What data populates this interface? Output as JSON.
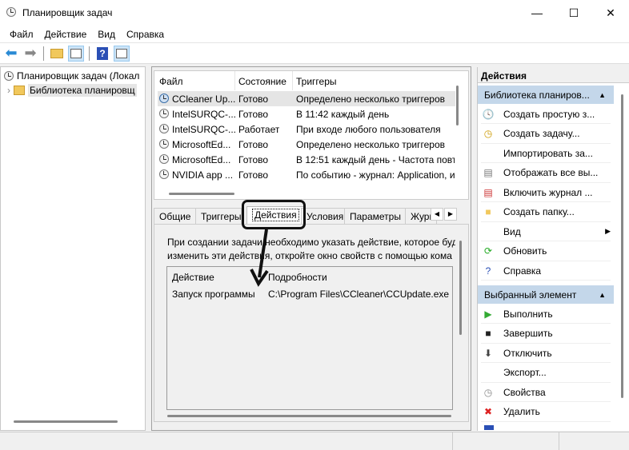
{
  "window": {
    "title": "Планировщик задач"
  },
  "menu": [
    "Файл",
    "Действие",
    "Вид",
    "Справка"
  ],
  "tree": {
    "root": "Планировщик задач (Локал",
    "library": "Библиотека планировщ"
  },
  "tasks": {
    "headers": [
      "Файл",
      "Состояние",
      "Триггеры"
    ],
    "rows": [
      {
        "name": "CCleaner Up...",
        "status": "Готово",
        "trigger": "Определено несколько триггеров"
      },
      {
        "name": "IntelSURQC-...",
        "status": "Готово",
        "trigger": "В 11:42 каждый день"
      },
      {
        "name": "IntelSURQC-...",
        "status": "Работает",
        "trigger": "При входе любого пользователя"
      },
      {
        "name": "MicrosoftEd...",
        "status": "Готово",
        "trigger": "Определено несколько триггеров"
      },
      {
        "name": "MicrosoftEd...",
        "status": "Готово",
        "trigger": "В 12:51 каждый день - Частота повто"
      },
      {
        "name": "NVIDIA app ...",
        "status": "Готово",
        "trigger": "По событию - журнал: Application, и"
      }
    ]
  },
  "tabs": [
    "Общие",
    "Триггеры",
    "Действия",
    "Условия",
    "Параметры",
    "Журнал"
  ],
  "details": {
    "description_line1": "При создании задачи необходимо указать действие, которое буд",
    "description_line2": "изменить эти действия, откройте окно свойств с помощью кома",
    "headers": [
      "Действие",
      "Подробности"
    ],
    "rows": [
      {
        "action": "Запуск программы",
        "details": "C:\\Program Files\\CCleaner\\CCUpdate.exe"
      }
    ]
  },
  "actions_pane": {
    "title": "Действия",
    "section1": "Библиотека планиров...",
    "items1": [
      "Создать простую з...",
      "Создать задачу...",
      "Импортировать за...",
      "Отображать все вы...",
      "Включить журнал ...",
      "Создать папку...",
      "Вид",
      "Обновить",
      "Справка"
    ],
    "section2": "Выбранный элемент",
    "items2": [
      "Выполнить",
      "Завершить",
      "Отключить",
      "Экспорт...",
      "Свойства",
      "Удалить"
    ]
  }
}
